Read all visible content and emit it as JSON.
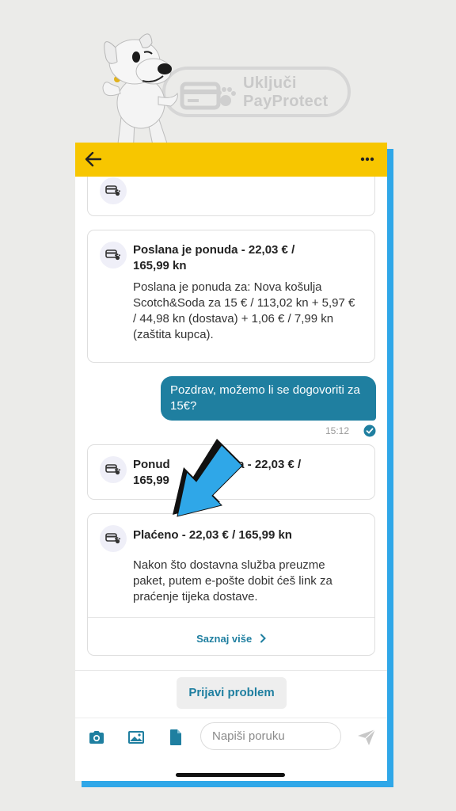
{
  "promo": {
    "line1": "Uključi",
    "line2": "PayProtect",
    "card_icon": "card-paw-icon",
    "mascot": "dog-mascot"
  },
  "header": {
    "back_icon": "arrow-left-icon",
    "menu_icon": "more-dots-icon",
    "color": "#f7c600"
  },
  "messages": [
    {
      "type": "system",
      "icon": "card-paw-icon",
      "title": "",
      "body": ""
    },
    {
      "type": "system",
      "icon": "card-paw-icon",
      "title": "Poslana je ponuda - 22,03 € / 165,99 kn",
      "body": "Poslana je ponuda za: Nova košulja Scotch&Soda za 15 € / 113,02 kn + 5,97 € / 44,98 kn (dostava) + 1,06 € / 7,99 kn (zaštita kupca)."
    },
    {
      "type": "user",
      "text": "Pozdrav, možemo li se dogovoriti za 15€?",
      "time": "15:12",
      "status_icon": "read-check-icon"
    },
    {
      "type": "system",
      "icon": "card-paw-icon",
      "title": "Ponuda je prihvaćena - 22,03 € / 165,99 kn",
      "visible_title": [
        "Ponud",
        "ena - 22,03 € /",
        "165,99"
      ]
    },
    {
      "type": "system",
      "icon": "card-paw-icon",
      "title": "Plaćeno - 22,03 € / 165,99 kn",
      "body": "Nakon što dostavna služba preuzme paket, putem e-pošte dobit ćeš link za praćenje tijeka dostave.",
      "link": "Saznaj više",
      "link_icon": "chevron-right-icon"
    }
  ],
  "actions": {
    "report_problem": "Prijavi problem"
  },
  "composer": {
    "placeholder": "Napiši poruku",
    "icons": [
      "camera-icon",
      "image-icon",
      "file-icon",
      "send-icon"
    ]
  },
  "colors": {
    "accent": "#1f7fa0",
    "brand_yellow": "#f7c600",
    "arrow_blue": "#2fa7e8"
  }
}
